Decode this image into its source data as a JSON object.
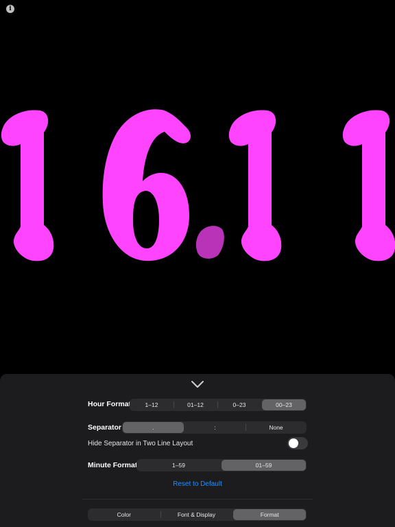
{
  "clock": {
    "hours": "16",
    "separator": ".",
    "minutes": "11",
    "digit_color": "#ff44ff",
    "separator_color": "#b833b8"
  },
  "info_icon": "info-icon",
  "panel": {
    "collapse_icon": "chevron-down-icon",
    "hour_format": {
      "label": "Hour Format",
      "options": [
        "1–12",
        "01–12",
        "0–23",
        "00–23"
      ],
      "selected": "00–23"
    },
    "separator": {
      "label": "Separator",
      "options": [
        ".",
        ":",
        "None"
      ],
      "selected": "."
    },
    "hide_separator": {
      "label": "Hide Separator in Two Line Layout",
      "enabled": false
    },
    "minute_format": {
      "label": "Minute Format",
      "options": [
        "1–59",
        "01–59"
      ],
      "selected": "01–59"
    },
    "reset_label": "Reset to Default",
    "tabs": {
      "items": [
        "Color",
        "Font & Display",
        "Format"
      ],
      "selected": "Format"
    }
  },
  "colors": {
    "panel_bg": "#1c1c1e",
    "segment_bg": "#2c2c2e",
    "segment_selected": "#636366",
    "link": "#1e90ff"
  }
}
